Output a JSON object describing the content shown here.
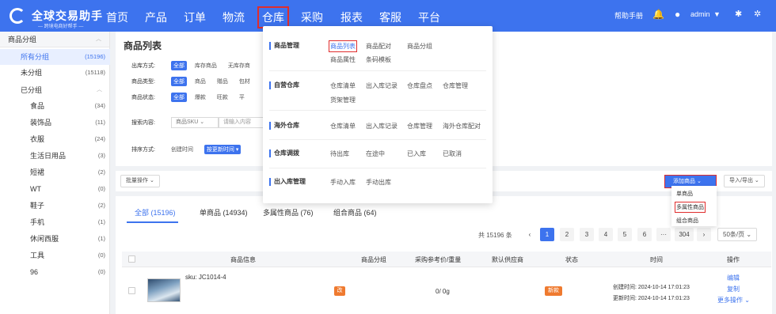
{
  "header": {
    "logo_title": "全球交易助手",
    "logo_subtitle": "— 跨境电商好帮手 —",
    "nav": [
      "首页",
      "产品",
      "订单",
      "物流",
      "仓库",
      "采购",
      "报表",
      "客服",
      "平台"
    ],
    "help": "帮助手册",
    "user": "admin",
    "brand_color": "#3d73ee"
  },
  "sidebar": {
    "title": "商品分组",
    "items": [
      {
        "label": "所有分组",
        "count": "(15196)"
      },
      {
        "label": "未分组",
        "count": "(15118)"
      },
      {
        "label": "已分组",
        "count": ""
      },
      {
        "label": "食品",
        "count": "(34)"
      },
      {
        "label": "装饰品",
        "count": "(11)"
      },
      {
        "label": "衣服",
        "count": "(24)"
      },
      {
        "label": "生活日用品",
        "count": "(3)"
      },
      {
        "label": "短裙",
        "count": "(2)"
      },
      {
        "label": "WT",
        "count": "(0)"
      },
      {
        "label": "鞋子",
        "count": "(2)"
      },
      {
        "label": "手机",
        "count": "(1)"
      },
      {
        "label": "休闲西服",
        "count": "(1)"
      },
      {
        "label": "工具",
        "count": "(0)"
      },
      {
        "label": "96",
        "count": "(0)"
      }
    ]
  },
  "page": {
    "title": "商品列表",
    "filters": {
      "out_label": "出库方式:",
      "out_all": "全部",
      "out_opts": [
        "库存商品",
        "无库存商"
      ],
      "type_label": "商品类型:",
      "type_all": "全部",
      "type_opts": [
        "商品",
        "赠品",
        "包材"
      ],
      "status_label": "商品状态:",
      "status_all": "全部",
      "status_opts": [
        "爆款",
        "旺款",
        "平"
      ],
      "search_label": "搜索内容:",
      "search_select": "商品SKU",
      "search_placeholder": "请输入内容",
      "sort_label": "排序方式:",
      "sort_opt1": "创建时间",
      "sort_opt2": "按更新时间"
    },
    "batch_button": "批量操作",
    "add_button": "添加商品",
    "import_button": "导入/导出",
    "tabs": [
      "全部 (15196)",
      "单商品 (14934)",
      "多属性商品 (76)",
      "组合商品 (64)"
    ],
    "pager": {
      "total": "共 15196 条",
      "pages": [
        "1",
        "2",
        "3",
        "4",
        "5",
        "6",
        "···",
        "304"
      ],
      "size": "50条/页"
    },
    "table": {
      "headers": [
        "商品信息",
        "商品分组",
        "采购参考价/重量",
        "默认供应商",
        "状态",
        "时间",
        "操作"
      ],
      "row": {
        "sku": "sku: JC1014-4",
        "tag": "改",
        "price_weight": "0/ 0g",
        "status": "新款",
        "created": "创建时间: 2024-10-14 17:01:23",
        "updated": "更新时间: 2024-10-14 17:01:23",
        "actions": [
          "编辑",
          "复制",
          "更多操作"
        ]
      }
    }
  },
  "warehouse_menu": [
    {
      "category": "商品管理",
      "links": [
        "商品列表",
        "商品配对",
        "商品分组",
        "商品属性",
        "条码模板"
      ]
    },
    {
      "category": "自营仓库",
      "links": [
        "仓库清单",
        "出入库记录",
        "仓库盘点",
        "仓库管理",
        "货架管理"
      ]
    },
    {
      "category": "海外仓库",
      "links": [
        "仓库清单",
        "出入库记录",
        "仓库管理",
        "海外仓库配对"
      ]
    },
    {
      "category": "仓库调拨",
      "links": [
        "待出库",
        "在途中",
        "已入库",
        "已取消"
      ]
    },
    {
      "category": "出入库管理",
      "links": [
        "手动入库",
        "手动出库"
      ]
    }
  ],
  "add_menu": [
    "单商品",
    "多属性商品",
    "组合商品"
  ]
}
